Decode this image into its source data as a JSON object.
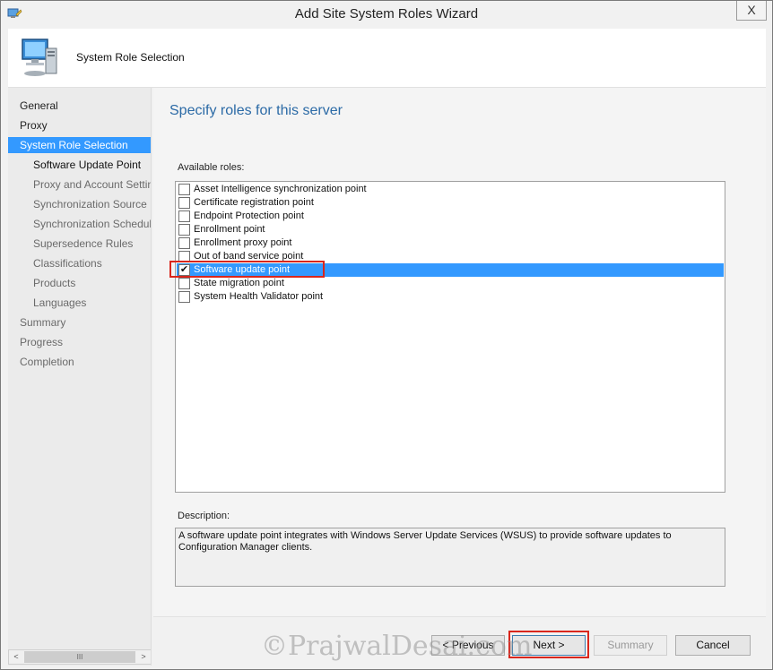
{
  "window": {
    "title": "Add Site System Roles Wizard",
    "close_glyph": "X"
  },
  "header": {
    "title": "System Role Selection",
    "icon": "computer-icon"
  },
  "nav": {
    "items": [
      {
        "label": "General",
        "level": "top"
      },
      {
        "label": "Proxy",
        "level": "top"
      },
      {
        "label": "System Role Selection",
        "level": "top",
        "selected": true
      },
      {
        "label": "Software Update Point",
        "level": "sub",
        "current": true
      },
      {
        "label": "Proxy and Account Settings",
        "level": "sub"
      },
      {
        "label": "Synchronization Source",
        "level": "sub"
      },
      {
        "label": "Synchronization Schedule",
        "level": "sub"
      },
      {
        "label": "Supersedence Rules",
        "level": "sub"
      },
      {
        "label": "Classifications",
        "level": "sub"
      },
      {
        "label": "Products",
        "level": "sub"
      },
      {
        "label": "Languages",
        "level": "sub"
      },
      {
        "label": "Summary",
        "level": "top"
      },
      {
        "label": "Progress",
        "level": "top"
      },
      {
        "label": "Completion",
        "level": "top"
      }
    ],
    "scroll_left": "<",
    "scroll_thumb": "III",
    "scroll_right": ">"
  },
  "main": {
    "page_title": "Specify roles for this server",
    "available_label": "Available roles:",
    "roles": [
      {
        "label": "Asset Intelligence synchronization point",
        "checked": false
      },
      {
        "label": "Certificate registration point",
        "checked": false
      },
      {
        "label": "Endpoint Protection point",
        "checked": false
      },
      {
        "label": "Enrollment point",
        "checked": false
      },
      {
        "label": "Enrollment proxy point",
        "checked": false
      },
      {
        "label": "Out of band service point",
        "checked": false
      },
      {
        "label": "Software update point",
        "checked": true,
        "selected": true
      },
      {
        "label": "State migration point",
        "checked": false
      },
      {
        "label": "System Health Validator point",
        "checked": false
      }
    ],
    "check_glyph": "✔",
    "description_label": "Description:",
    "description": "A software update point integrates with Windows Server Update Services (WSUS) to provide software updates to Configuration Manager clients."
  },
  "footer": {
    "previous": "< Previous",
    "next": "Next >",
    "summary": "Summary",
    "cancel": "Cancel"
  },
  "watermark": "©PrajwalDesai.com",
  "colors": {
    "selection": "#3399ff",
    "title_blue": "#2b6aa6",
    "annotation_red": "#d9261c"
  }
}
